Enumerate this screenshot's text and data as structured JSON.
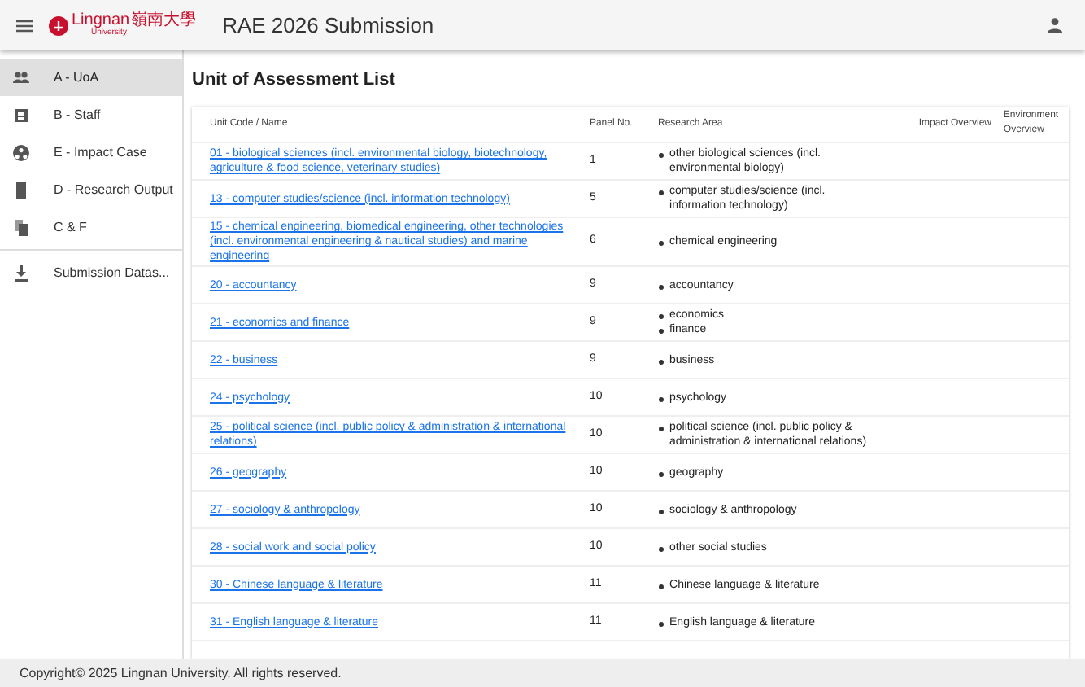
{
  "header": {
    "logo": {
      "name": "Lingnan",
      "chinese": "嶺南大學",
      "sub": "University"
    },
    "title": "RAE 2026 Submission"
  },
  "sidebar": {
    "items": [
      {
        "label": "A - UoA",
        "selected": true
      },
      {
        "label": "B - Staff",
        "selected": false
      },
      {
        "label": "E - Impact Case",
        "selected": false
      },
      {
        "label": "D - Research Output",
        "selected": false
      },
      {
        "label": "C & F",
        "selected": false
      },
      {
        "label": "Submission Datas...",
        "selected": false
      }
    ]
  },
  "page_title": "Unit of Assessment List",
  "table": {
    "columns": [
      "Unit Code / Name",
      "Panel No.",
      "Research Area",
      "Impact Overview",
      "Environment Overview"
    ],
    "rows": [
      {
        "unit": "01 - biological sciences (incl. environmental biology, biotechnology, agriculture & food science, veterinary studies)",
        "panel": "1",
        "areas": [
          "other biological sciences (incl. environmental biology)"
        ]
      },
      {
        "unit": "13 - computer studies/science (incl. information technology)",
        "panel": "5",
        "areas": [
          "computer studies/science (incl. information technology)"
        ]
      },
      {
        "unit": "15 - chemical engineering, biomedical engineering, other technologies (incl. environmental engineering & nautical studies) and marine engineering",
        "panel": "6",
        "areas": [
          "chemical engineering"
        ]
      },
      {
        "unit": "20 - accountancy",
        "panel": "9",
        "areas": [
          "accountancy"
        ]
      },
      {
        "unit": "21 - economics and finance",
        "panel": "9",
        "areas": [
          "economics",
          "finance"
        ]
      },
      {
        "unit": "22 - business",
        "panel": "9",
        "areas": [
          "business"
        ]
      },
      {
        "unit": "24 - psychology",
        "panel": "10",
        "areas": [
          "psychology"
        ]
      },
      {
        "unit": "25 - political science (incl. public policy & administration & international relations)",
        "panel": "10",
        "areas": [
          "political science (incl. public policy & administration & international relations)"
        ]
      },
      {
        "unit": "26 - geography",
        "panel": "10",
        "areas": [
          "geography"
        ]
      },
      {
        "unit": "27 - sociology & anthropology",
        "panel": "10",
        "areas": [
          "sociology & anthropology"
        ]
      },
      {
        "unit": "28 - social work and social policy",
        "panel": "10",
        "areas": [
          "other social studies"
        ]
      },
      {
        "unit": "30 - Chinese language & literature",
        "panel": "11",
        "areas": [
          "Chinese language & literature"
        ]
      },
      {
        "unit": "31 - English language & literature",
        "panel": "11",
        "areas": [
          "English language & literature"
        ]
      }
    ]
  },
  "footer": "Copyright© 2025 Lingnan University. All rights reserved."
}
